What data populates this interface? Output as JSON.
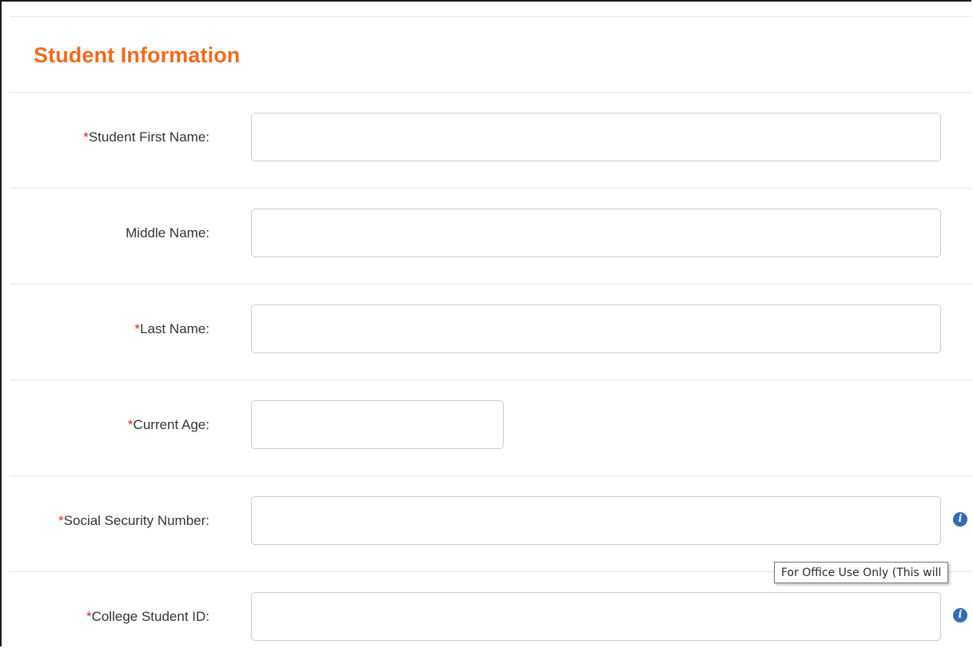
{
  "section": {
    "title": "Student Information"
  },
  "fields": {
    "first_name": {
      "required_mark": "*",
      "label": "Student First Name:",
      "value": ""
    },
    "middle_name": {
      "required_mark": "",
      "label": "Middle Name:",
      "value": ""
    },
    "last_name": {
      "required_mark": "*",
      "label": "Last Name:",
      "value": ""
    },
    "current_age": {
      "required_mark": "*",
      "label": "Current Age:",
      "value": ""
    },
    "ssn": {
      "required_mark": "*",
      "label": "Social Security Number:",
      "value": "",
      "icon": "info-icon"
    },
    "college_id": {
      "required_mark": "*",
      "label": "College Student ID:",
      "value": "",
      "icon": "info-icon"
    }
  },
  "icons": {
    "info_glyph": "i"
  },
  "tooltip": {
    "text": "For Office Use Only (This will"
  },
  "colors": {
    "title": "#f26a1b",
    "required": "#d9261c",
    "info_icon": "#2f6db5"
  }
}
